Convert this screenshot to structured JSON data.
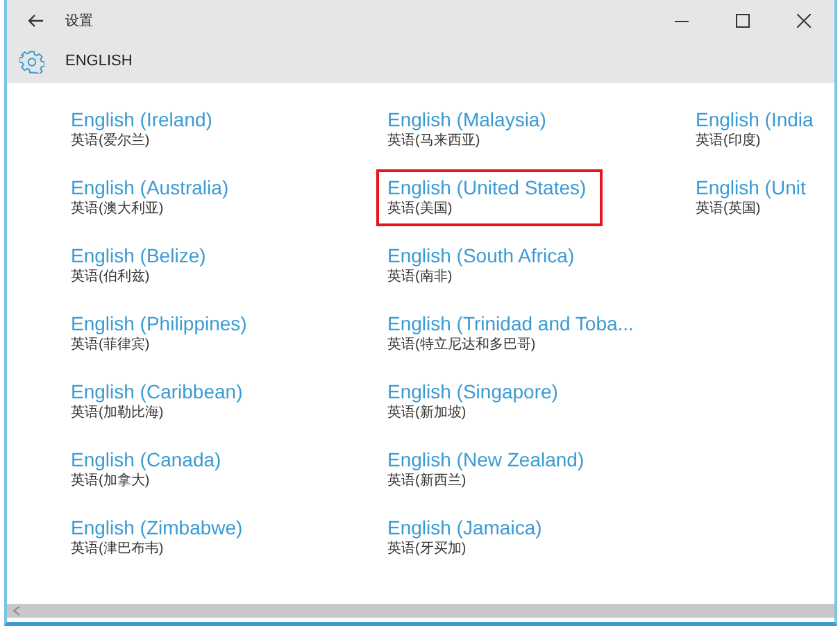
{
  "window": {
    "title": "设置"
  },
  "header": {
    "title": "ENGLISH"
  },
  "columns": [
    {
      "items": [
        {
          "name": "English (Ireland)",
          "native": "英语(爱尔兰)",
          "selected": false
        },
        {
          "name": "English (Australia)",
          "native": "英语(澳大利亚)",
          "selected": false
        },
        {
          "name": "English (Belize)",
          "native": "英语(伯利兹)",
          "selected": false
        },
        {
          "name": "English (Philippines)",
          "native": "英语(菲律宾)",
          "selected": false
        },
        {
          "name": "English (Caribbean)",
          "native": "英语(加勒比海)",
          "selected": false
        },
        {
          "name": "English (Canada)",
          "native": "英语(加拿大)",
          "selected": false
        },
        {
          "name": "English (Zimbabwe)",
          "native": "英语(津巴布韦)",
          "selected": false
        }
      ]
    },
    {
      "items": [
        {
          "name": "English (Malaysia)",
          "native": "英语(马来西亚)",
          "selected": false
        },
        {
          "name": "English (United States)",
          "native": "英语(美国)",
          "selected": true
        },
        {
          "name": "English (South Africa)",
          "native": "英语(南非)",
          "selected": false
        },
        {
          "name": "English (Trinidad and Toba...",
          "native": "英语(特立尼达和多巴哥)",
          "selected": false
        },
        {
          "name": "English (Singapore)",
          "native": "英语(新加坡)",
          "selected": false
        },
        {
          "name": "English (New Zealand)",
          "native": "英语(新西兰)",
          "selected": false
        },
        {
          "name": "English (Jamaica)",
          "native": "英语(牙买加)",
          "selected": false
        }
      ]
    },
    {
      "items": [
        {
          "name": "English (India",
          "native": "英语(印度)",
          "selected": false
        },
        {
          "name": "English (Unit",
          "native": "英语(英国)",
          "selected": false
        }
      ]
    }
  ]
}
